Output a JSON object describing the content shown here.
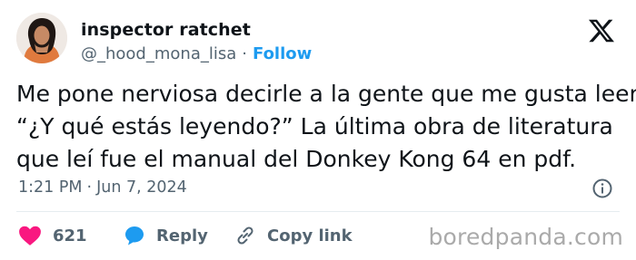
{
  "tweet": {
    "display_name": "inspector ratchet",
    "handle": "@_hood_mona_lisa",
    "separator": "·",
    "follow_label": "Follow",
    "text_lines": [
      "Me pone nerviosa decirle a la gente que me gusta leer.",
      "“¿Y qué estás leyendo?” La última obra de literatura",
      "que leí fue el manual del Donkey Kong 64 en pdf."
    ],
    "time": "1:21 PM",
    "date": "Jun 7, 2024",
    "meta_separator": "·"
  },
  "actions": {
    "like_count": "621",
    "reply_label": "Reply",
    "copy_link_label": "Copy link"
  },
  "watermark": "boredpanda.com",
  "icons": {
    "logo": "x-logo-icon",
    "info": "info-icon",
    "like": "heart-icon",
    "reply": "reply-bubble-icon",
    "copy": "link-icon"
  },
  "colors": {
    "follow": "#1d9bf0",
    "heart": "#f91880",
    "reply_bubble": "#1d9bf0",
    "muted": "#536471",
    "text": "#0f1419"
  }
}
